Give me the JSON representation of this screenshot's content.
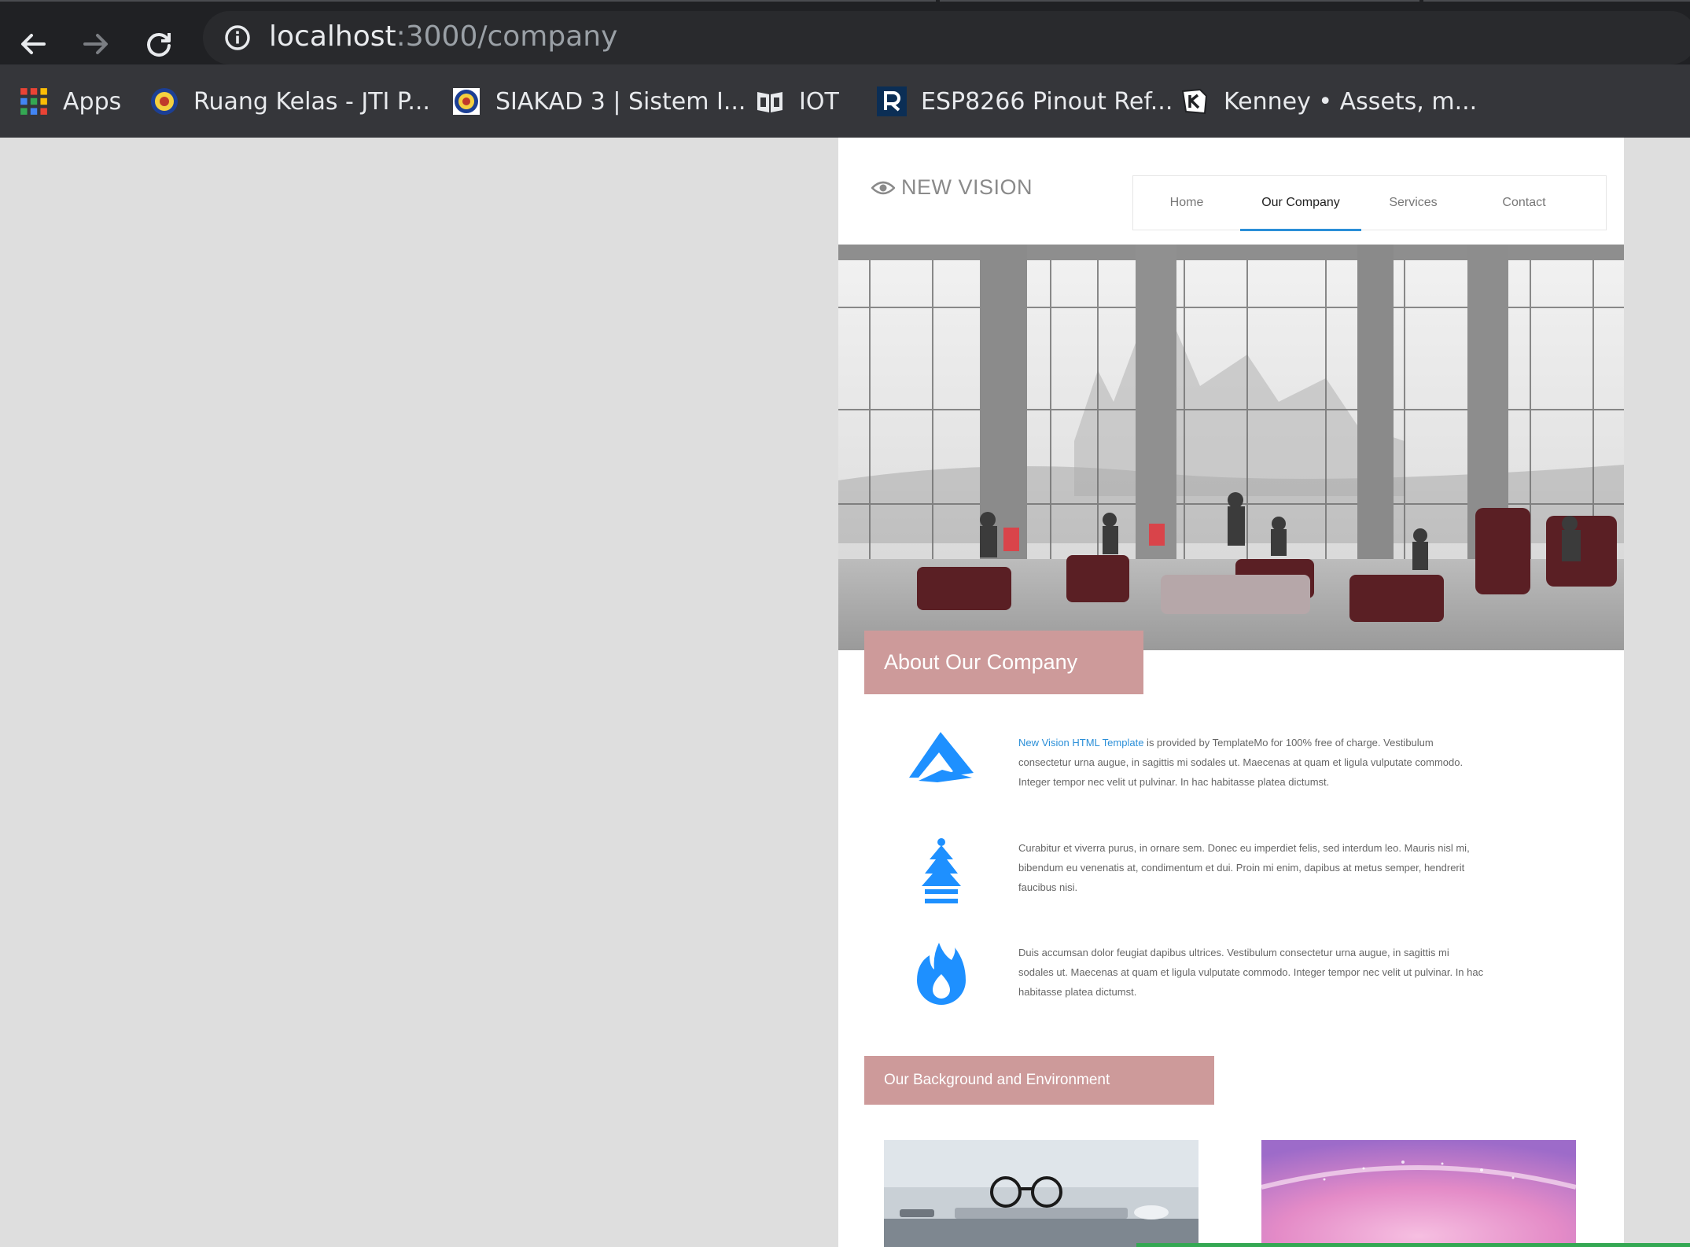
{
  "browser": {
    "url_host": "localhost",
    "url_path": ":3000/company",
    "bookmarks": [
      {
        "label": "Apps",
        "icon": "apps-grid-icon"
      },
      {
        "label": "Ruang Kelas - JTI P...",
        "icon": "polinema-logo-icon"
      },
      {
        "label": "SIAKAD 3 | Sistem I...",
        "icon": "polinema-logo-icon"
      },
      {
        "label": "IOT",
        "icon": "book-icon"
      },
      {
        "label": "ESP8266 Pinout Ref...",
        "icon": "r-logo-icon"
      },
      {
        "label": "Kenney • Assets, m...",
        "icon": "kenney-logo-icon"
      }
    ]
  },
  "site": {
    "logo_text": "NEW VISION",
    "nav": [
      {
        "label": "Home",
        "active": false
      },
      {
        "label": "Our Company",
        "active": true
      },
      {
        "label": "Services",
        "active": false
      },
      {
        "label": "Contact",
        "active": false
      }
    ],
    "about_title": "About Our Company",
    "features": [
      {
        "icon": "paper-plane-icon",
        "link_text": "New Vision HTML Template",
        "text": " is provided by TemplateMo for 100% free of charge. Vestibulum consectetur urna augue, in sagittis mi sodales ut. Maecenas at quam et ligula vulputate commodo. Integer tempor nec velit ut pulvinar. In hac habitasse platea dictumst."
      },
      {
        "icon": "tree-icon",
        "text": "Curabitur et viverra purus, in ornare sem. Donec eu imperdiet felis, sed interdum leo. Mauris nisl mi, bibendum eu venenatis at, condimentum et dui. Proin mi enim, dapibus at metus semper, hendrerit faucibus nisi."
      },
      {
        "icon": "flame-icon",
        "text": "Duis accumsan dolor feugiat dapibus ultrices. Vestibulum consectetur urna augue, in sagittis mi sodales ut. Maecenas at quam et ligula vulputate commodo. Integer tempor nec velit ut pulvinar. In hac habitasse platea dictumst."
      }
    ],
    "background_title": "Our Background and Environment"
  },
  "colors": {
    "accent_blue": "#1e90ff",
    "section_pink": "#cd9a9a",
    "nav_underline": "#2b8fd8",
    "load_bar": "#34a853"
  }
}
